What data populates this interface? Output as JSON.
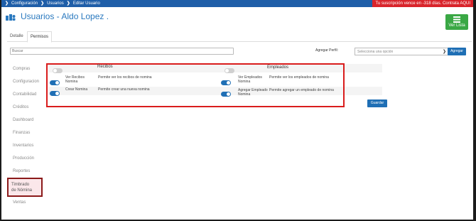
{
  "topbar": {
    "breadcrumbs": [
      "Configuración",
      "Usuarios",
      "Editar Usuario"
    ],
    "subscription_notice": "Tu suscripción vence en -318 días. Contrata AQUI"
  },
  "header": {
    "title": "Usuarios - Aldo Lopez .",
    "list_button_label": "Ver Lista"
  },
  "tabs": [
    "Detalle",
    "Permisos"
  ],
  "search": {
    "placeholder": "Buscar"
  },
  "profile": {
    "label": "Agregar Perfil:",
    "select_value": "Selecciona una opción",
    "add_button": "Agregar"
  },
  "sidebar": {
    "items": [
      "Compras",
      "Configuracion",
      "Contabilidad",
      "Créditos",
      "Dashboard",
      "Finanzas",
      "Inventarios",
      "Producción",
      "Reportes",
      "Timbrado de Nómina",
      "Ventas"
    ],
    "highlighted_line1": "Timbrado",
    "highlighted_line2": "de Nómina"
  },
  "permissions": {
    "recibos": {
      "title": "Recibos",
      "header_toggle": "off",
      "rows": [
        {
          "name_line1": "Ver Recibos",
          "name_line2": "Nomina",
          "desc": "Permite ver los recibos de nomina",
          "toggle": "on"
        },
        {
          "name_line1": "Crear Nomina",
          "name_line2": "",
          "desc": "Permite crear una nueva nomina",
          "toggle": "on"
        }
      ]
    },
    "empleados": {
      "title": "Empleados",
      "header_toggle": "off",
      "rows": [
        {
          "name_line1": "Ver Empleados",
          "name_line2": "Nomina",
          "desc": "Permite ver los empleados de nomina",
          "toggle": "on"
        },
        {
          "name_line1": "Agregar Empleado",
          "name_line2": "Nomina",
          "desc": "Permite agregar un empleado de nomina",
          "toggle": "on"
        }
      ]
    }
  },
  "save_button": "Guardar",
  "colors": {
    "primary": "#1f6fb5",
    "danger": "#d91c1c",
    "success": "#3aa845",
    "highlight_border": "#8b1a1a"
  }
}
